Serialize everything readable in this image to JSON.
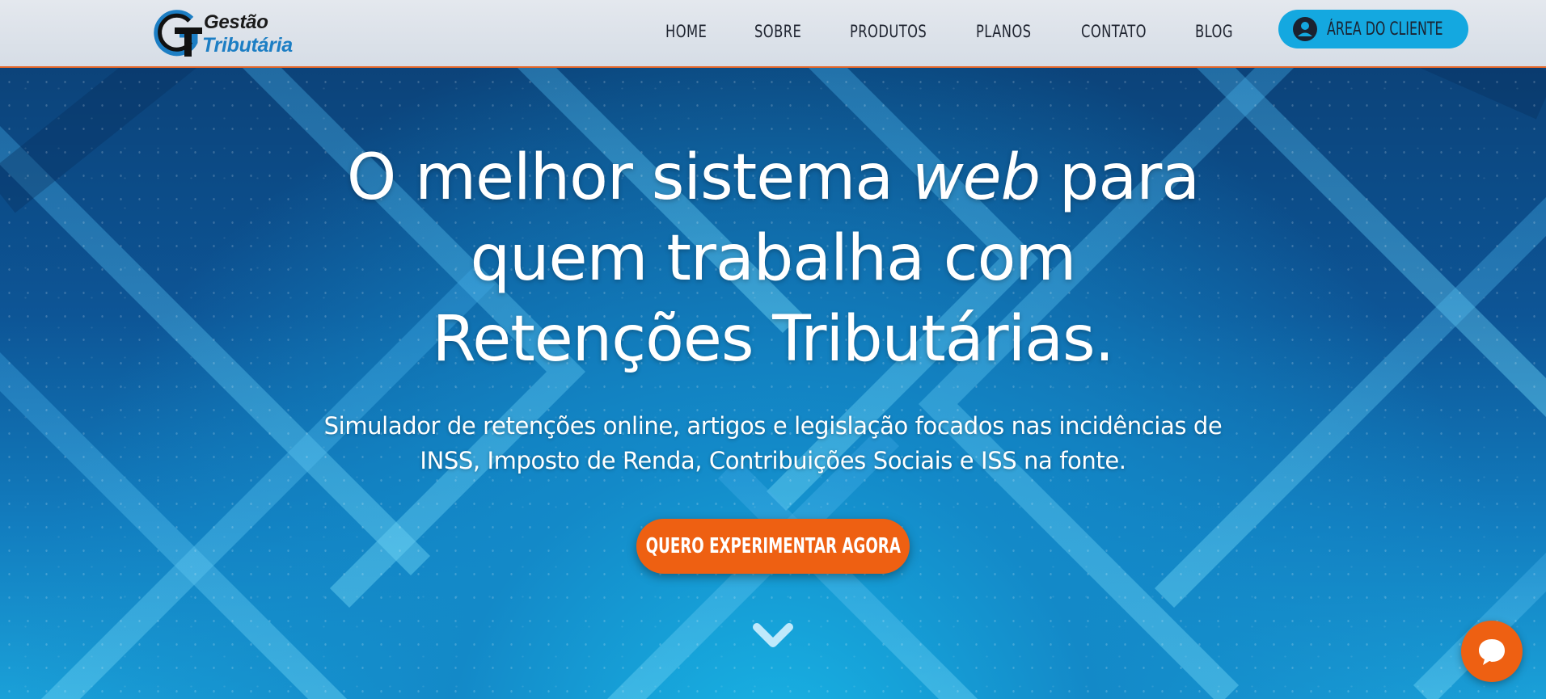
{
  "colors": {
    "accent_orange": "#ee6012",
    "accent_blue": "#14a8e0",
    "logo_blue": "#1c7ec4",
    "header_bg": "#dfe4eb"
  },
  "logo": {
    "line1": "Gestão",
    "line2": "Tributária",
    "mark_icon": "gt-logo-mark"
  },
  "nav": {
    "items": [
      {
        "label": "HOME"
      },
      {
        "label": "SOBRE"
      },
      {
        "label": "PRODUTOS"
      },
      {
        "label": "PLANOS"
      },
      {
        "label": "CONTATO"
      },
      {
        "label": "BLOG"
      }
    ],
    "client_area": {
      "label": "ÁREA DO CLIENTE",
      "icon": "user-circle-icon"
    }
  },
  "hero": {
    "headline_pre": "O melhor sistema ",
    "headline_em": "web",
    "headline_post": " para",
    "headline_line2": "quem trabalha com",
    "headline_line3": "Retenções Tributárias.",
    "subtitle_line1": "Simulador de retenções online, artigos e legislação focados nas incidências de",
    "subtitle_line2": "INSS, Imposto de Renda, Contribuições Sociais e ISS na fonte.",
    "cta_label": "QUERO EXPERIMENTAR AGORA",
    "scroll_icon": "chevron-down-icon"
  },
  "chat": {
    "icon": "chat-bubble-icon"
  }
}
